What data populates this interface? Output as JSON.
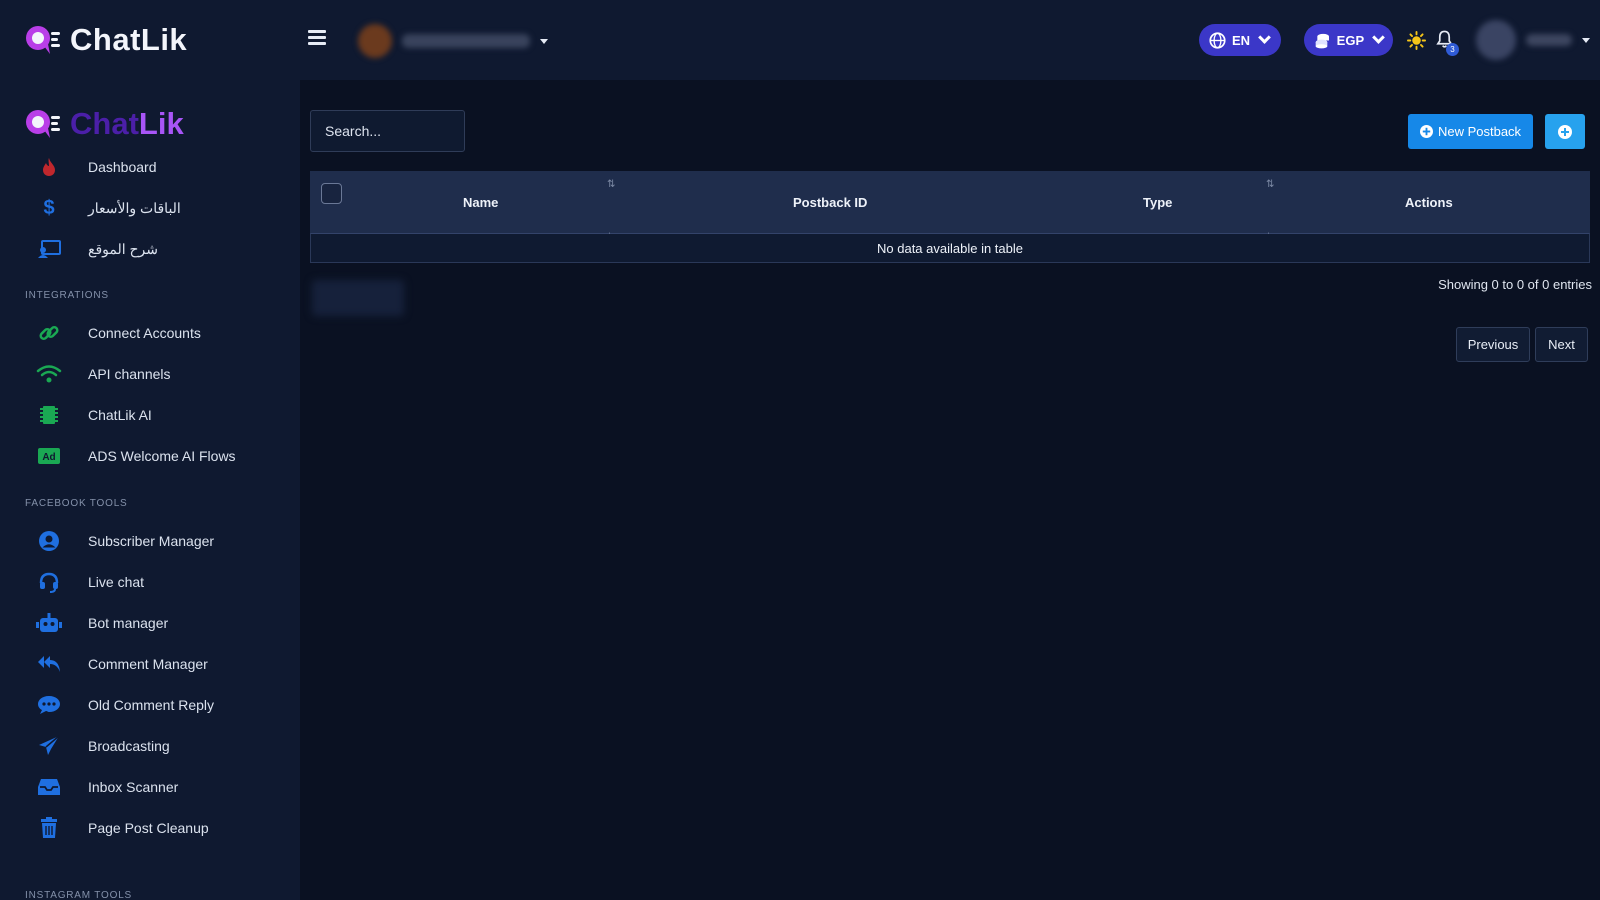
{
  "header": {
    "brand": "ChatLik",
    "language": "EN",
    "currency": "EGP",
    "notifications_count": "3"
  },
  "sidebar": {
    "brand_chat": "Chat",
    "brand_lik": "Lik",
    "items_top": [
      {
        "label": "Dashboard",
        "icon": "fire-icon",
        "color": "#c0272d"
      },
      {
        "label": "الباقات والأسعار",
        "icon": "dollar-icon",
        "color": "#1f6fe0"
      },
      {
        "label": "شرح الموقع",
        "icon": "presentation-icon",
        "color": "#1f6fe0"
      }
    ],
    "section_integrations": "INTEGRATIONS",
    "items_integrations": [
      {
        "label": "Connect Accounts",
        "icon": "link-icon",
        "color": "#1aa853"
      },
      {
        "label": "API channels",
        "icon": "wifi-icon",
        "color": "#1aa853"
      },
      {
        "label": "ChatLik AI",
        "icon": "chip-icon",
        "color": "#1aa853"
      },
      {
        "label": "ADS Welcome AI Flows",
        "icon": "ad-icon",
        "color": "#1aa853"
      }
    ],
    "section_facebook": "FACEBOOK TOOLS",
    "items_facebook": [
      {
        "label": "Subscriber Manager",
        "icon": "user-circle-icon",
        "color": "#1f6fe0"
      },
      {
        "label": "Live chat",
        "icon": "headset-icon",
        "color": "#1f6fe0"
      },
      {
        "label": "Bot manager",
        "icon": "robot-icon",
        "color": "#1f6fe0"
      },
      {
        "label": "Comment Manager",
        "icon": "reply-all-icon",
        "color": "#1f6fe0"
      },
      {
        "label": "Old Comment Reply",
        "icon": "comment-dots-icon",
        "color": "#1f6fe0"
      },
      {
        "label": "Broadcasting",
        "icon": "paper-plane-icon",
        "color": "#1f6fe0"
      },
      {
        "label": "Inbox Scanner",
        "icon": "inbox-icon",
        "color": "#1f6fe0"
      },
      {
        "label": "Page Post Cleanup",
        "icon": "trash-icon",
        "color": "#1f6fe0"
      }
    ],
    "section_instagram": "INSTAGRAM TOOLS"
  },
  "main": {
    "search_placeholder": "Search...",
    "new_button": "New Postback",
    "table": {
      "columns": [
        "Name",
        "Postback ID",
        "Type",
        "Actions"
      ],
      "empty_message": "No data available in table"
    },
    "info": "Showing 0 to 0 of 0 entries",
    "previous": "Previous",
    "next": "Next"
  },
  "colors": {
    "accent_blue": "#1688e8",
    "pill_purple": "#3b37c8",
    "brand_purple": "#a855f7"
  }
}
